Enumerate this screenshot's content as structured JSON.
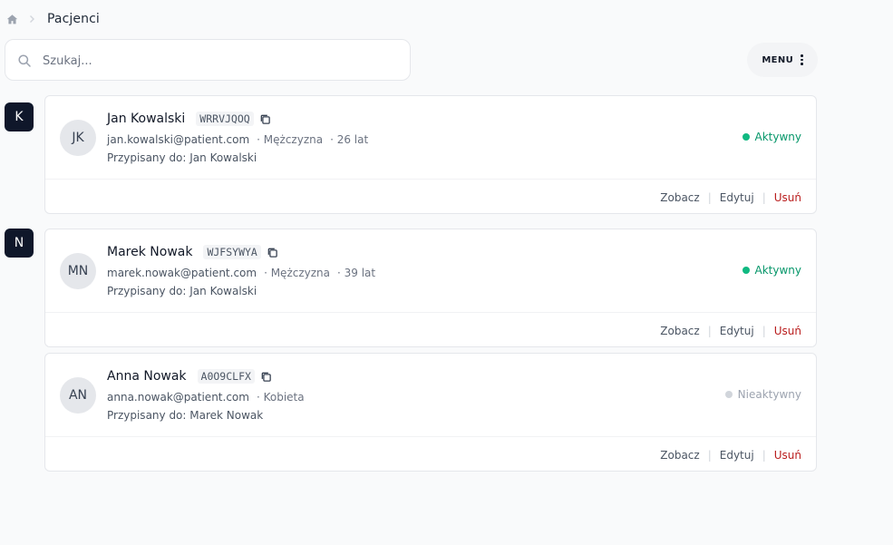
{
  "breadcrumb": {
    "icon": "home-icon",
    "label": "Pacjenci"
  },
  "search": {
    "placeholder": "Szukaj...",
    "value": ""
  },
  "menu": {
    "label": "MENU"
  },
  "groups": [
    {
      "letter": "K"
    },
    {
      "letter": "N"
    }
  ],
  "patients": [
    {
      "initials": "JK",
      "name": "Jan Kowalski",
      "code": "WRRVJQOQ",
      "email": "jan.kowalski@patient.com",
      "gender": "· Mężczyzna",
      "age": "· 26 lat",
      "assigned": "Przypisany do: Jan Kowalski",
      "status": "Aktywny"
    },
    {
      "initials": "MN",
      "name": "Marek Nowak",
      "code": "WJFSYWYA",
      "email": "marek.nowak@patient.com",
      "gender": "· Mężczyzna",
      "age": "· 39 lat",
      "assigned": "Przypisany do: Jan Kowalski",
      "status": "Aktywny"
    },
    {
      "initials": "AN",
      "name": "Anna Nowak",
      "code": "A0O9CLFX",
      "email": "anna.nowak@patient.com",
      "gender": "· Kobieta",
      "age": "",
      "assigned": "Przypisany do: Marek Nowak",
      "status": "Nieaktywny"
    }
  ],
  "actions": {
    "view": "Zobacz",
    "edit": "Edytuj",
    "delete": "Usuń",
    "separator": "|"
  },
  "colors": {
    "active": "#10b981",
    "inactive": "#d1d5db",
    "delete": "#b91c1c",
    "badge": "#0f172a"
  }
}
